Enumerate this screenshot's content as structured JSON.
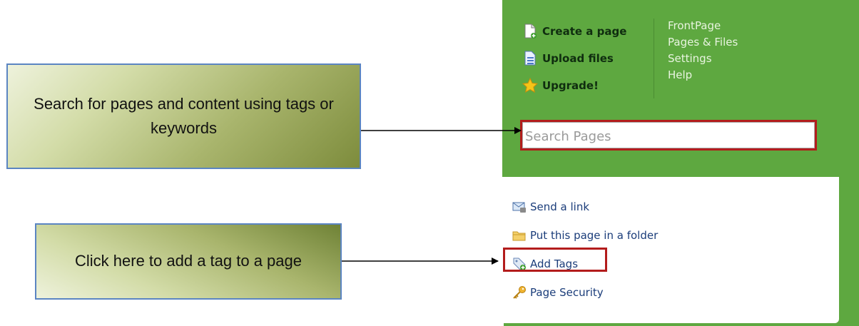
{
  "callouts": {
    "search": "Search for pages and content using tags or keywords",
    "tags": "Click here to add a tag to a page"
  },
  "actions": [
    {
      "label": "Create a page",
      "icon": "page-add-icon"
    },
    {
      "label": "Upload files",
      "icon": "upload-files-icon"
    },
    {
      "label": "Upgrade!",
      "icon": "star-icon"
    }
  ],
  "nav": [
    "FrontPage",
    "Pages & Files",
    "Settings",
    "Help"
  ],
  "search": {
    "placeholder": "Search Pages"
  },
  "page_links": [
    {
      "label": "Send a link",
      "icon": "mail-icon"
    },
    {
      "label": "Put this page in a folder",
      "icon": "folder-icon"
    },
    {
      "label": "Add Tags",
      "icon": "tag-add-icon"
    },
    {
      "label": "Page Security",
      "icon": "key-icon"
    }
  ],
  "colors": {
    "panel_green": "#5ea840",
    "highlight_red": "#b31c1c",
    "callout_border": "#5b85c2"
  }
}
